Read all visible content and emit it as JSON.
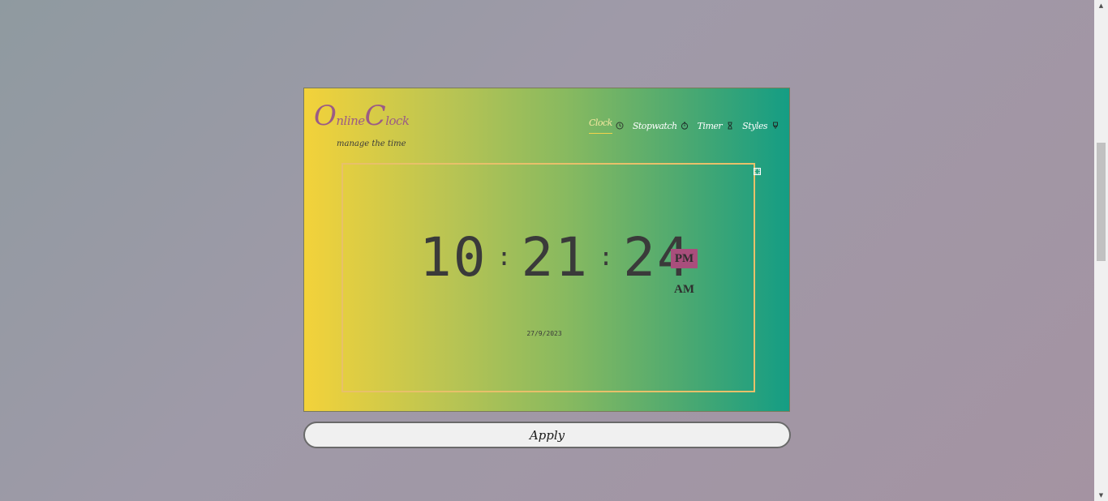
{
  "logo": {
    "first_initial": "O",
    "first_rest": "nline",
    "second_initial": "C",
    "second_rest": "lock"
  },
  "tagline": "manage the time",
  "nav": {
    "items": [
      {
        "label": "Clock",
        "icon": "clock-icon",
        "active": true
      },
      {
        "label": "Stopwatch",
        "icon": "stopwatch-icon",
        "active": false
      },
      {
        "label": "Timer",
        "icon": "hourglass-icon",
        "active": false
      },
      {
        "label": "Styles",
        "icon": "brush-icon",
        "active": false
      }
    ]
  },
  "clock": {
    "hours": "10",
    "minutes": "21",
    "seconds": "24",
    "separator": ":",
    "pm_label": "PM",
    "am_label": "AM",
    "selected_period": "PM",
    "date": "27/9/2023"
  },
  "apply_button": "Apply",
  "colors": {
    "gradient_start": "#f3d23a",
    "gradient_end": "#149d84",
    "accent": "#a94e7c",
    "frame_border": "#e8c06a",
    "digit_color": "#3a3a3a"
  }
}
